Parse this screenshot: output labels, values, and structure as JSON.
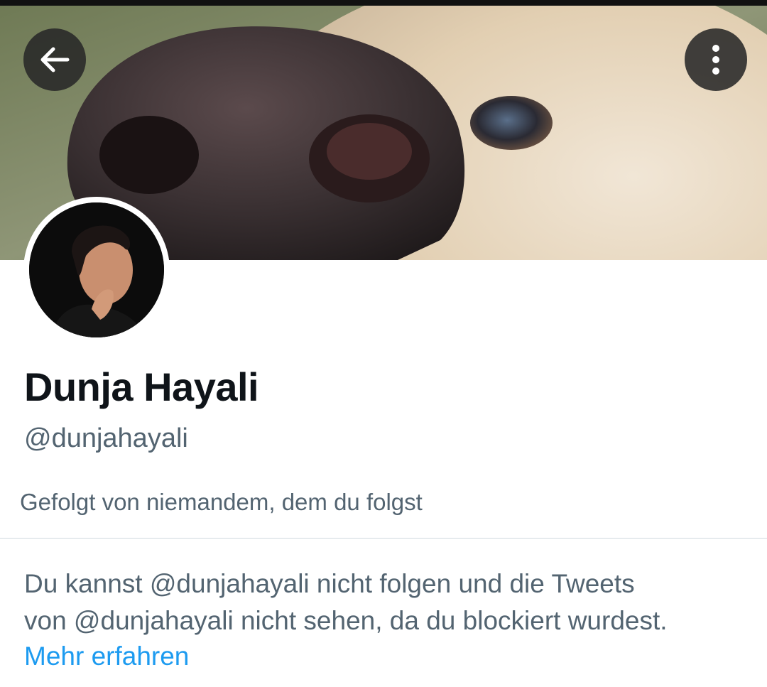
{
  "profile": {
    "name": "Dunja Hayali",
    "handle": "@dunjahayali",
    "followed_by": "Gefolgt von niemandem, dem du folgst",
    "blocked_notice_line1": "Du kannst @dunjahayali nicht folgen und die Tweets",
    "blocked_notice_line2": "von @dunjahayali nicht sehen, da du blockiert wurdest.",
    "learn_more": "Mehr erfahren"
  },
  "icons": {
    "back": "arrow-left-icon",
    "more": "more-vertical-icon"
  },
  "colors": {
    "text_primary": "#0f1419",
    "text_secondary": "#536471",
    "link": "#1d9bf0",
    "divider": "#cfd9de"
  }
}
